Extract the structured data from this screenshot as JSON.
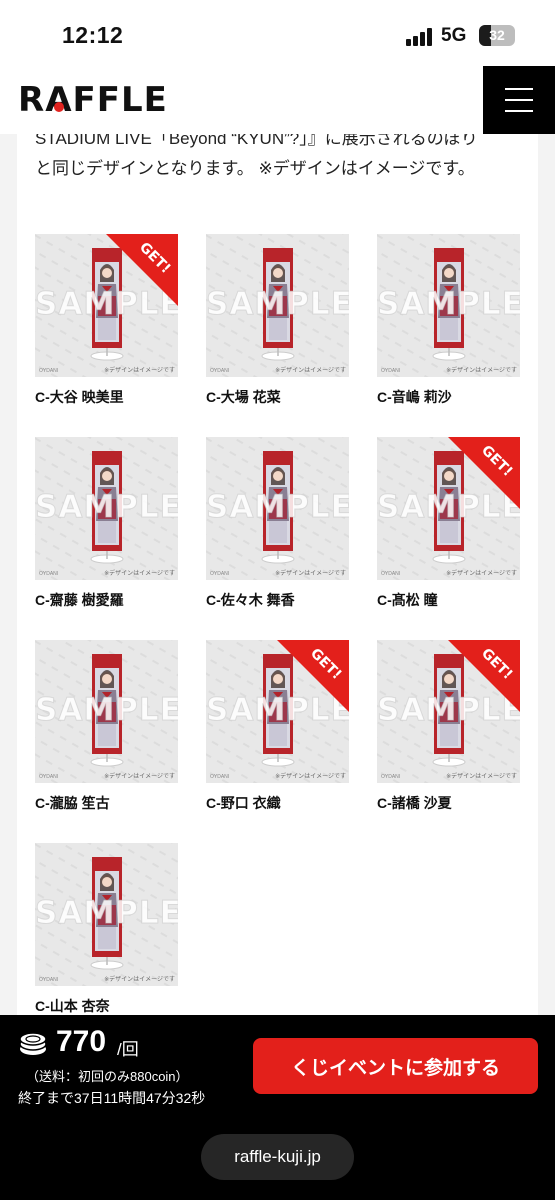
{
  "status_bar": {
    "time": "12:12",
    "network": "5G",
    "battery": "32",
    "battery_level": 0.32
  },
  "header": {
    "logo_text": "RAFFLE",
    "menu_icon": "hamburger-menu-icon"
  },
  "description": {
    "line1": "STADIUM LIVE「Beyond “KYUN”?」』に展示されるのぼり",
    "line2": "と同じデザインとなります。 ※デザインはイメージです。"
  },
  "thumbnail": {
    "watermark": "SAMPLE",
    "note": "※デザインはイメージです",
    "brand": "OYDANI",
    "get_label": "GET!"
  },
  "items": [
    {
      "name": "C-大谷 映美里",
      "get": true
    },
    {
      "name": "C-大場 花菜",
      "get": false
    },
    {
      "name": "C-音嶋 莉沙",
      "get": false
    },
    {
      "name": "C-齋藤 樹愛羅",
      "get": false
    },
    {
      "name": "C-佐々木 舞香",
      "get": false
    },
    {
      "name": "C-髙松 瞳",
      "get": true
    },
    {
      "name": "C-瀧脇 笙古",
      "get": false
    },
    {
      "name": "C-野口 衣織",
      "get": true
    },
    {
      "name": "C-諸橋 沙夏",
      "get": true
    },
    {
      "name": "C-山本 杏奈",
      "get": false
    }
  ],
  "purchase": {
    "coin_icon": "coin-stack-icon",
    "price": "770",
    "per": "/回",
    "shipping": "（送料：初回のみ880coin）",
    "time_left": "終了まで37日11時間47分32秒",
    "join_label": "くじイベントに参加する"
  },
  "browser": {
    "url": "raffle-kuji.jp"
  },
  "colors": {
    "accent": "#e3201b",
    "banner_red": "#b8242a"
  }
}
